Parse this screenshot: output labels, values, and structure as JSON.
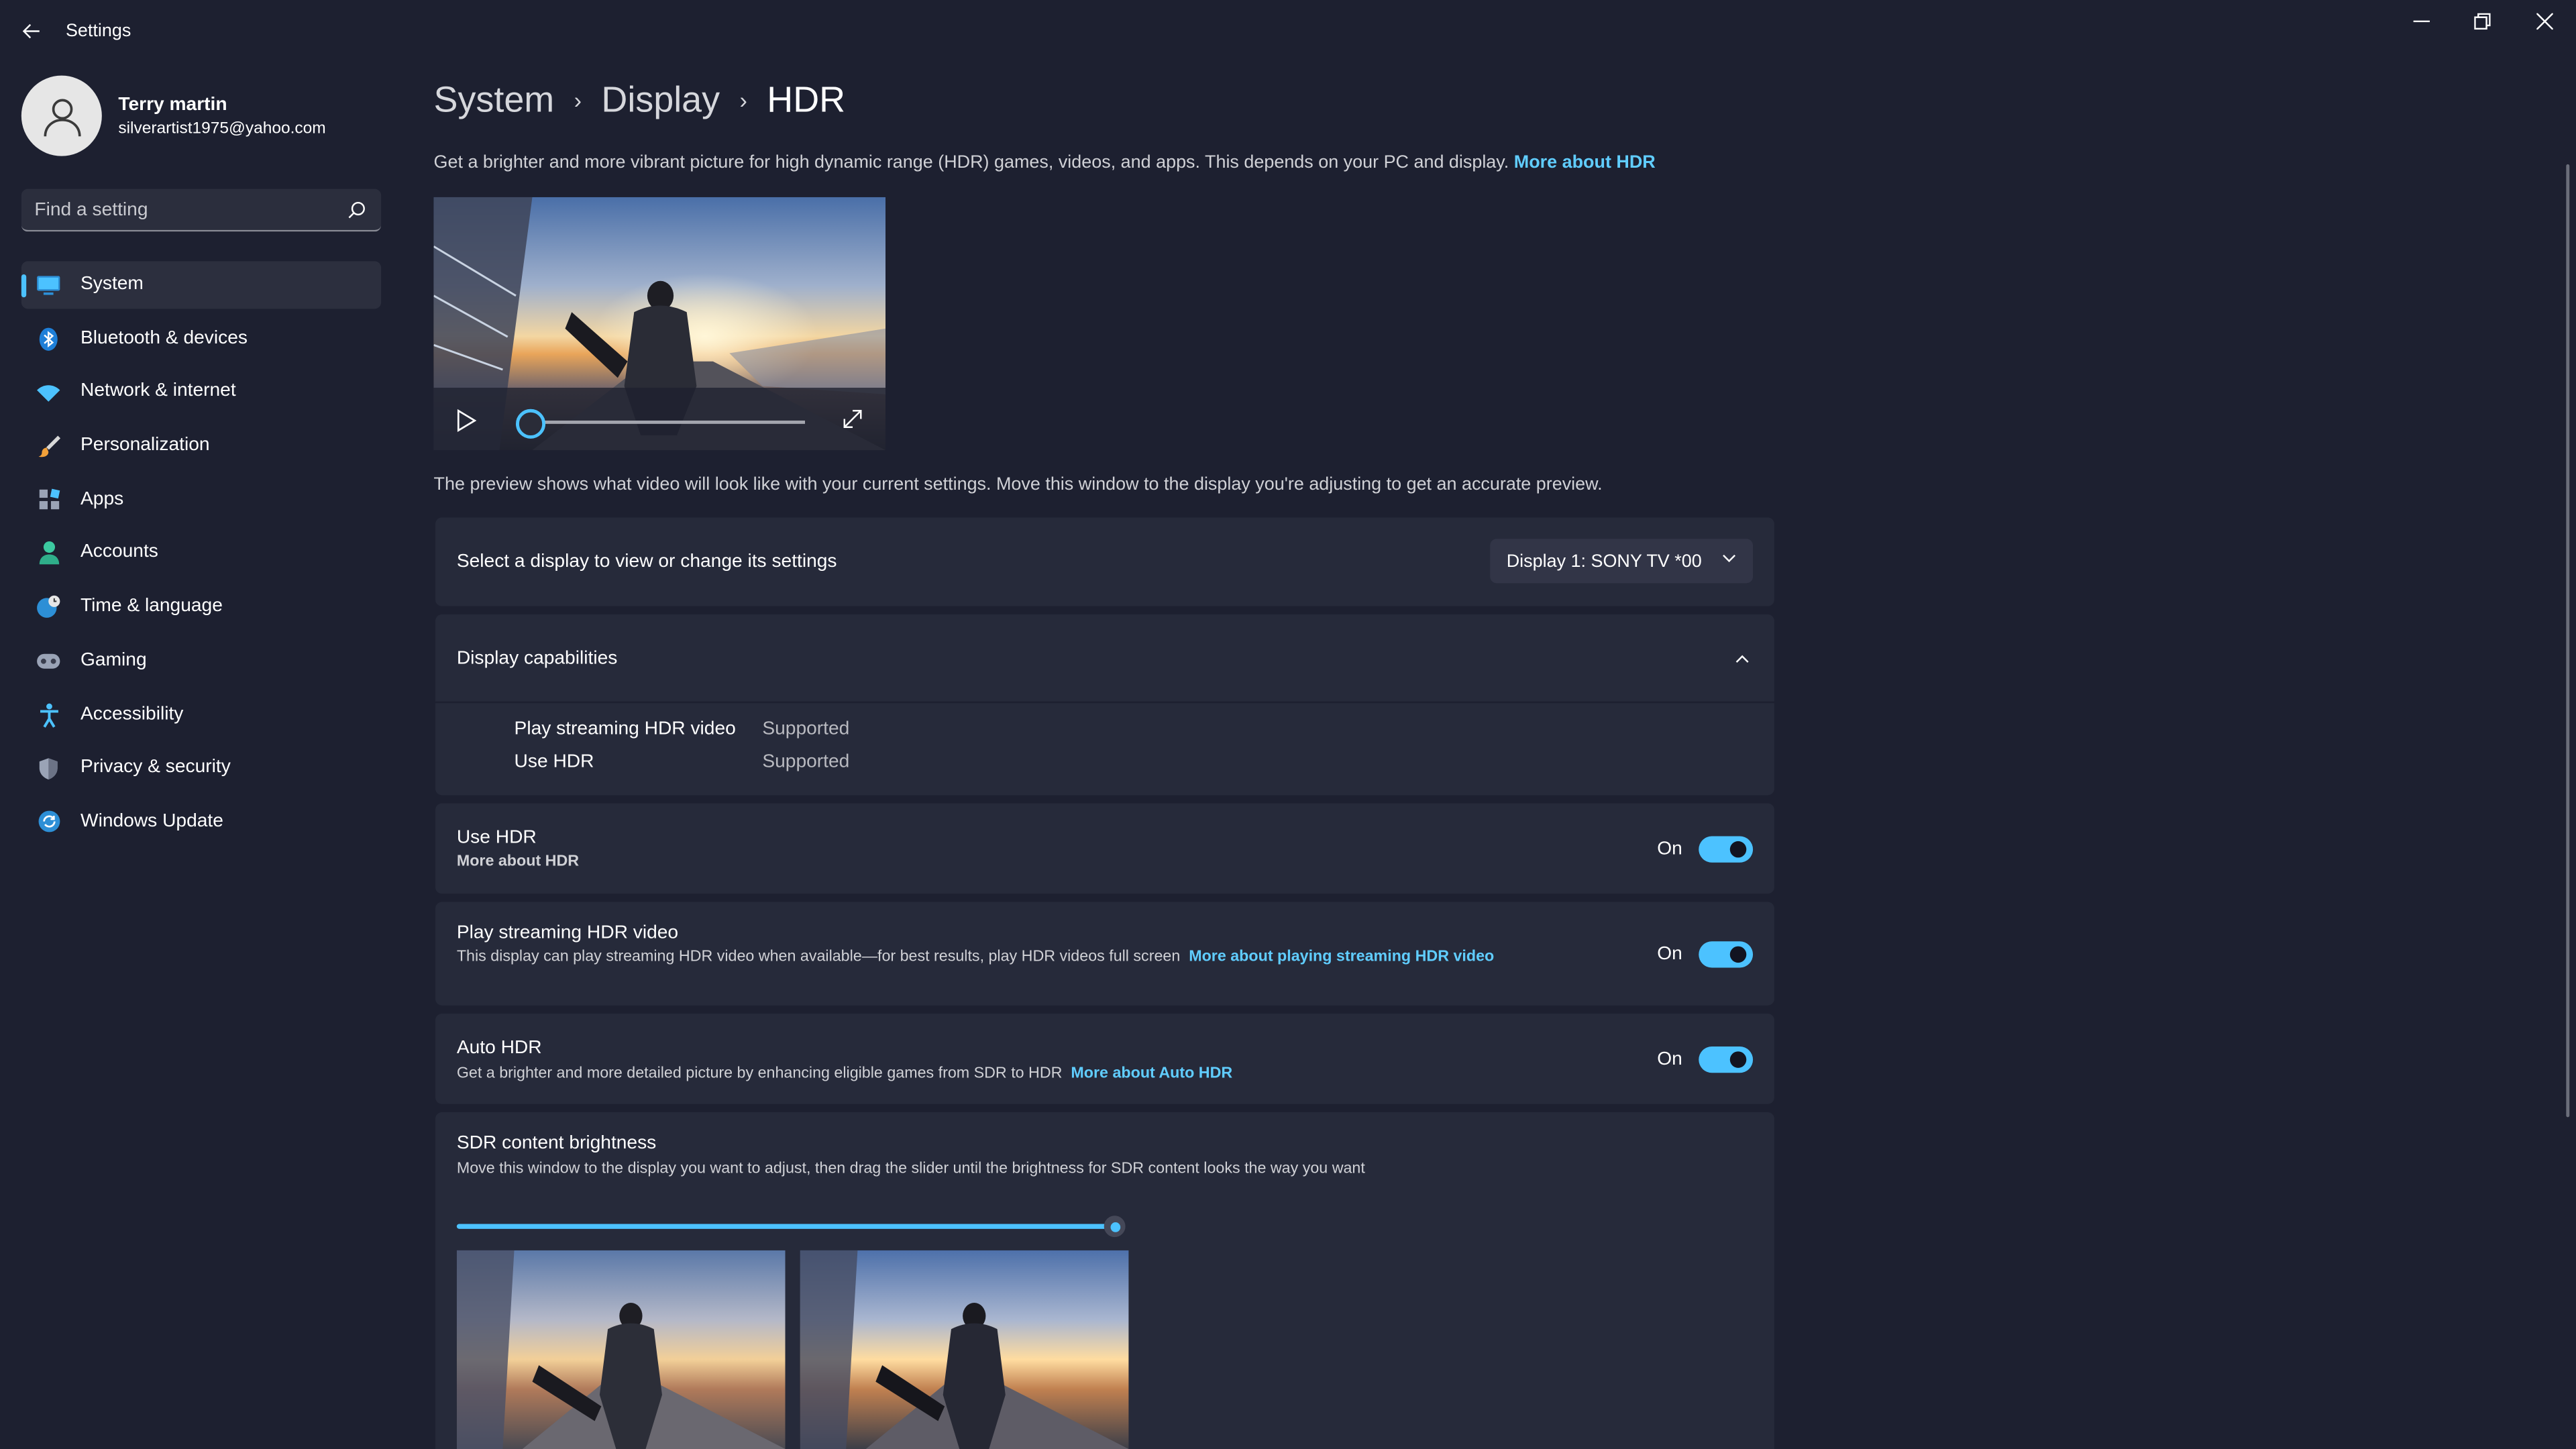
{
  "window": {
    "title": "Settings",
    "back_icon": "arrow-left-icon",
    "minimize_icon": "minimize-icon",
    "restore_icon": "restore-icon",
    "close_icon": "close-icon"
  },
  "user": {
    "name": "Terry martin",
    "email": "silverartist1975@yahoo.com"
  },
  "search": {
    "placeholder": "Find a setting"
  },
  "sidebar": {
    "items": [
      {
        "label": "System",
        "icon": "monitor-icon",
        "active": true
      },
      {
        "label": "Bluetooth & devices",
        "icon": "bluetooth-icon"
      },
      {
        "label": "Network & internet",
        "icon": "wifi-icon"
      },
      {
        "label": "Personalization",
        "icon": "brush-icon"
      },
      {
        "label": "Apps",
        "icon": "apps-icon"
      },
      {
        "label": "Accounts",
        "icon": "person-icon"
      },
      {
        "label": "Time & language",
        "icon": "globe-clock-icon"
      },
      {
        "label": "Gaming",
        "icon": "gamepad-icon"
      },
      {
        "label": "Accessibility",
        "icon": "accessibility-icon"
      },
      {
        "label": "Privacy & security",
        "icon": "shield-icon"
      },
      {
        "label": "Windows Update",
        "icon": "update-icon"
      }
    ]
  },
  "breadcrumb": {
    "items": [
      "System",
      "Display",
      "HDR"
    ],
    "separator": "›"
  },
  "intro": {
    "text": "Get a brighter and more vibrant picture for high dynamic range (HDR) games, videos, and apps. This depends on your PC and display.",
    "link": "More about HDR"
  },
  "video": {
    "progress": 0
  },
  "preview_note": "The preview shows what video will look like with your current settings. Move this window to the display you're adjusting to get an accurate preview.",
  "display_select": {
    "label": "Select a display to view or change its settings",
    "value": "Display 1: SONY TV  *00"
  },
  "capabilities": {
    "title": "Display capabilities",
    "rows": [
      {
        "name": "Play streaming HDR video",
        "value": "Supported"
      },
      {
        "name": "Use HDR",
        "value": "Supported"
      }
    ]
  },
  "use_hdr": {
    "title": "Use HDR",
    "link": "More about HDR",
    "state": "On"
  },
  "streaming_hdr": {
    "title": "Play streaming HDR video",
    "desc": "This display can play streaming HDR video when available—for best results, play HDR videos full screen",
    "link": "More about playing streaming HDR video",
    "state": "On"
  },
  "auto_hdr": {
    "title": "Auto HDR",
    "desc": "Get a brighter and more detailed picture by enhancing eligible games from SDR to HDR",
    "link": "More about Auto HDR",
    "state": "On"
  },
  "sdr_brightness": {
    "title": "SDR content brightness",
    "desc": "Move this window to the display you want to adjust, then drag the slider until the brightness for SDR content looks the way you want",
    "value_fraction": 1.0
  },
  "colors": {
    "accent": "#4cc2ff",
    "link": "#60cdff",
    "background": "#1d2030",
    "card": "#262a3a"
  }
}
